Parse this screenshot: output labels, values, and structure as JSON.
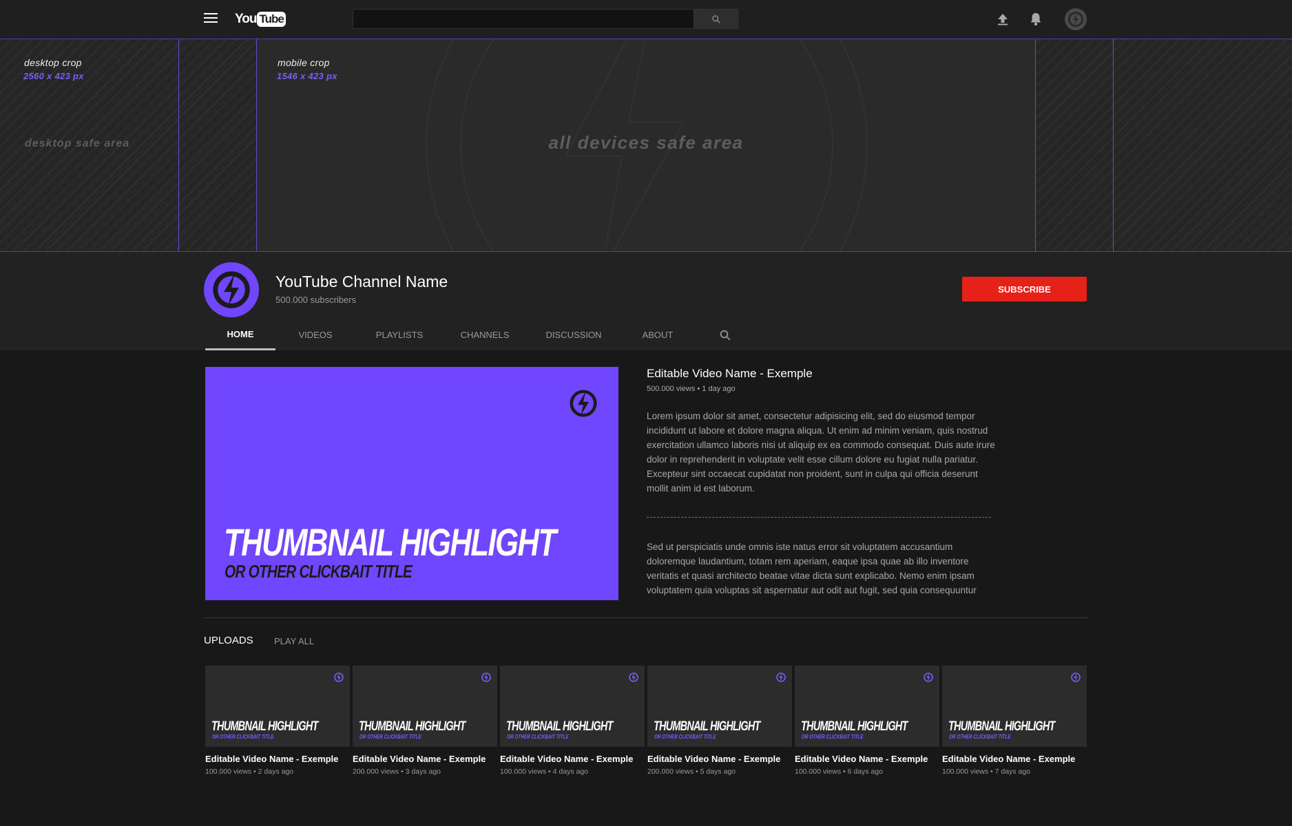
{
  "colors": {
    "accent": "#7047ff",
    "subscribe": "#e62117",
    "background": "#181818"
  },
  "topbar": {
    "menu_icon": "hamburger-menu-icon",
    "logo_you": "You",
    "logo_tube": "Tube",
    "search_placeholder": "",
    "search_icon": "search-icon",
    "upload_icon": "upload-icon",
    "notifications_icon": "bell-icon",
    "avatar_icon": "channel-logo-icon"
  },
  "banner": {
    "desktop_crop_label": "desktop crop",
    "desktop_crop_size": "2560 x 423 px",
    "mobile_crop_label": "mobile crop",
    "mobile_crop_size": "1546 x 423 px",
    "desktop_safe_label": "desktop safe area",
    "all_devices_safe_label": "all devices safe area"
  },
  "channel": {
    "name": "YouTube Channel Name",
    "subscribers": "500.000 subscribers",
    "subscribe_label": "SUBSCRIBE"
  },
  "tabs": {
    "home": "HOME",
    "videos": "VIDEOS",
    "playlists": "PLAYLISTS",
    "channels": "CHANNELS",
    "discussion": "DISCUSSION",
    "about": "ABOUT"
  },
  "featured": {
    "thumb_title": "THUMBNAIL HIGHLIGHT",
    "thumb_subtitle": "OR OTHER CLICKBAIT TITLE",
    "title": "Editable Video Name - Exemple",
    "meta": "500.000 views • 1 day ago",
    "description_1": "Lorem ipsum dolor sit amet, consectetur adipisicing elit, sed do eiusmod tempor incididunt ut labore et dolore magna aliqua. Ut enim ad minim veniam, quis nostrud exercitation ullamco laboris nisi ut aliquip ex ea commodo consequat. Duis aute irure dolor in reprehenderit in voluptate velit esse cillum dolore eu fugiat nulla pariatur. Excepteur sint occaecat cupidatat non proident, sunt in culpa qui officia deserunt mollit anim id est laborum.",
    "description_2": "Sed ut perspiciatis unde omnis iste natus error sit voluptatem accusantium doloremque laudantium, totam rem aperiam, eaque ipsa quae ab illo inventore veritatis et quasi architecto beatae vitae dicta sunt explicabo. Nemo enim ipsam voluptatem quia voluptas sit aspernatur aut odit aut fugit, sed quia consequuntur"
  },
  "uploads": {
    "label": "UPLOADS",
    "play_all": "PLAY ALL",
    "videos": [
      {
        "thumb_title": "THUMBNAIL HIGHLIGHT",
        "thumb_subtitle": "OR OTHER CLICKBAIT TITLE",
        "title": "Editable Video Name - Exemple",
        "meta": "100.000 views • 2 days ago"
      },
      {
        "thumb_title": "THUMBNAIL HIGHLIGHT",
        "thumb_subtitle": "OR OTHER CLICKBAIT TITLE",
        "title": "Editable Video Name - Exemple",
        "meta": "200.000 views • 3 days ago"
      },
      {
        "thumb_title": "THUMBNAIL HIGHLIGHT",
        "thumb_subtitle": "OR OTHER CLICKBAIT TITLE",
        "title": "Editable Video Name - Exemple",
        "meta": "100.000 views • 4 days ago"
      },
      {
        "thumb_title": "THUMBNAIL HIGHLIGHT",
        "thumb_subtitle": "OR OTHER CLICKBAIT TITLE",
        "title": "Editable Video Name - Exemple",
        "meta": "200.000 views • 5 days ago"
      },
      {
        "thumb_title": "THUMBNAIL HIGHLIGHT",
        "thumb_subtitle": "OR OTHER CLICKBAIT TITLE",
        "title": "Editable Video Name - Exemple",
        "meta": "100.000 views • 6 days ago"
      },
      {
        "thumb_title": "THUMBNAIL HIGHLIGHT",
        "thumb_subtitle": "OR OTHER CLICKBAIT TITLE",
        "title": "Editable Video Name - Exemple",
        "meta": "100.000 views • 7 days ago"
      }
    ]
  }
}
